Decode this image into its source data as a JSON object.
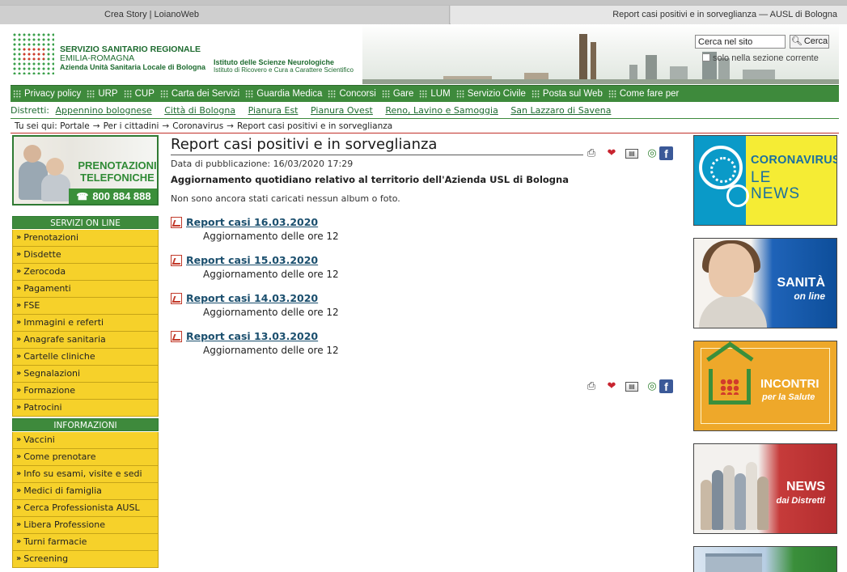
{
  "browser": {
    "tabs": [
      {
        "label": "Crea Story | LoianoWeb",
        "active": false
      },
      {
        "label": "Report casi positivi e in sorveglianza — AUSL di Bologna",
        "active": true
      }
    ]
  },
  "header": {
    "org_line1": "SERVIZIO SANITARIO REGIONALE",
    "org_line2": "EMILIA-ROMAGNA",
    "org_line3": "Azienda Unità Sanitaria Locale di Bologna",
    "inst_line1": "Istituto delle Scienze Neurologiche",
    "inst_line2": "Istituto di Ricovero e Cura a Carattere Scientifico",
    "search_placeholder": "Cerca nel sito",
    "search_value": "Cerca nel sito",
    "search_button": "Cerca",
    "search_option": "solo nella sezione corrente"
  },
  "mainnav": [
    "Privacy policy",
    "URP",
    "CUP",
    "Carta dei Servizi",
    "Guardia Medica",
    "Concorsi",
    "Gare",
    "LUM",
    "Servizio Civile",
    "Posta sul Web",
    "Come fare per"
  ],
  "districts": {
    "label": "Distretti:",
    "items": [
      "Appennino bolognese",
      "Città di Bologna",
      "Pianura Est",
      "Pianura Ovest",
      "Reno, Lavino e Samoggia",
      "San Lazzaro di Savena"
    ]
  },
  "breadcrumb": {
    "label": "Tu sei qui:",
    "items": [
      "Portale",
      "Per i cittadini",
      "Coronavirus",
      "Report casi positivi e in sorveglianza"
    ]
  },
  "promo": {
    "line1": "PRENOTAZIONI",
    "line2": "TELEFONICHE",
    "phone": "800 884 888"
  },
  "menus": [
    {
      "title": "SERVIZI ON LINE",
      "items": [
        "Prenotazioni",
        "Disdette",
        "Zerocoda",
        "Pagamenti",
        "FSE",
        "Immagini e referti",
        "Anagrafe sanitaria",
        "Cartelle cliniche",
        "Segnalazioni",
        "Formazione",
        "Patrocini"
      ]
    },
    {
      "title": "INFORMAZIONI",
      "items": [
        "Vaccini",
        "Come prenotare",
        "Info su esami, visite e sedi",
        "Medici di famiglia",
        "Cerca Professionista AUSL",
        "Libera Professione",
        "Turni farmacie",
        "Screening"
      ]
    }
  ],
  "content": {
    "title": "Report casi positivi e in sorveglianza",
    "pubdate": "Data di pubblicazione: 16/03/2020 17:29",
    "subtitle": "Aggiornamento quotidiano relativo al territorio dell'Azienda USL di Bologna",
    "no_album": "Non sono ancora stati caricati nessun album o foto.",
    "reports": [
      {
        "label": "Report casi 16.03.2020",
        "desc": "Aggiornamento delle ore 12"
      },
      {
        "label": "Report casi 15.03.2020",
        "desc": "Aggiornamento delle ore 12"
      },
      {
        "label": "Report casi 14.03.2020",
        "desc": "Aggiornamento delle ore 12"
      },
      {
        "label": "Report casi 13.03.2020",
        "desc": "Aggiornamento delle ore 12"
      }
    ]
  },
  "banners": {
    "b1_line1": "CORONAVIRUS",
    "b1_line2": "LE",
    "b1_line3": "NEWS",
    "b2_line1": "SANITÀ",
    "b2_line2": "on line",
    "b3_line1": "INCONTRI",
    "b3_line2": "per la Salute",
    "b4_line1": "NEWS",
    "b4_line2": "dai Distretti"
  },
  "icons": {
    "print": "print-icon",
    "favorite": "heart-icon",
    "share": "share-icon",
    "web": "globe-icon",
    "facebook": "facebook-icon"
  },
  "colors": {
    "brand_green": "#3e8a3c",
    "menu_yellow": "#f6d12a",
    "link_blue": "#1b4f6e",
    "accent_red": "#c0302a"
  }
}
